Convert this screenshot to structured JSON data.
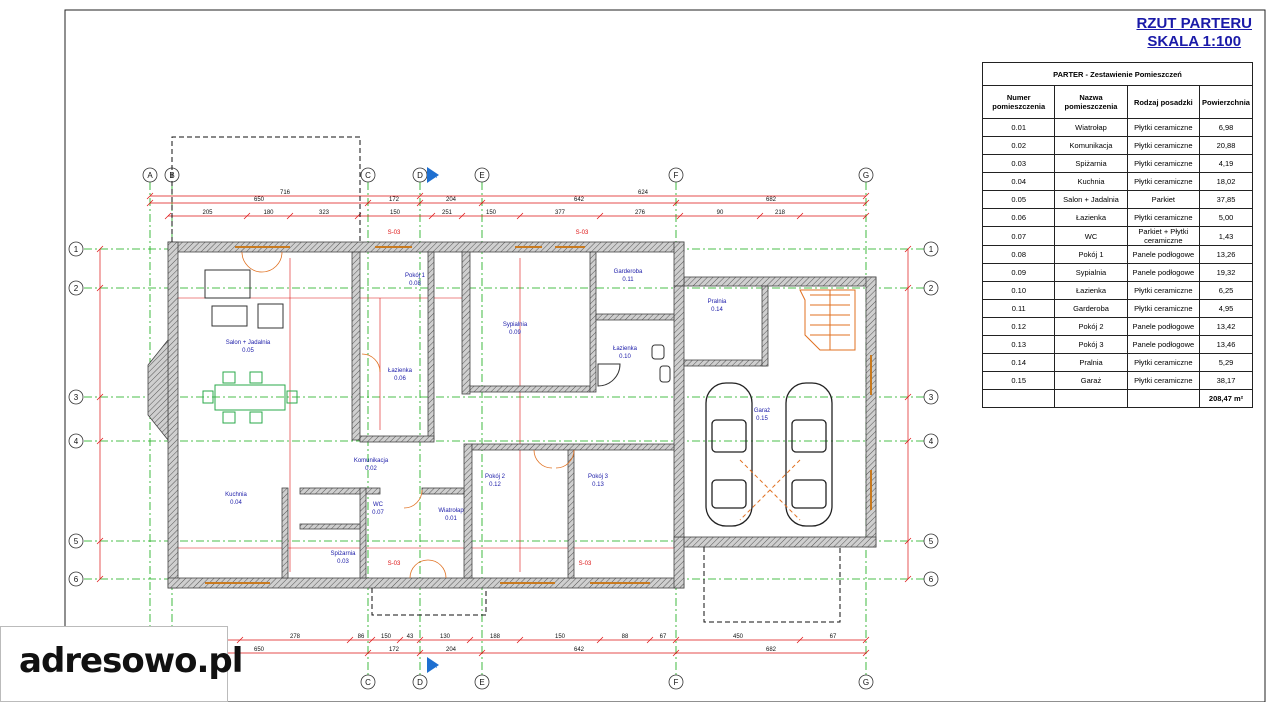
{
  "title": {
    "line1": "RZUT PARTERU",
    "line2": "SKALA 1:100"
  },
  "table": {
    "caption": "PARTER - Zestawienie Pomieszczeń",
    "headers": [
      "Numer pomieszczenia",
      "Nazwa pomieszczenia",
      "Rodzaj posadzki",
      "Powierzchnia"
    ],
    "rows": [
      [
        "0.01",
        "Wiatrołap",
        "Płytki ceramiczne",
        "6,98"
      ],
      [
        "0.02",
        "Komunikacja",
        "Płytki ceramiczne",
        "20,88"
      ],
      [
        "0.03",
        "Spiżarnia",
        "Płytki ceramiczne",
        "4,19"
      ],
      [
        "0.04",
        "Kuchnia",
        "Płytki ceramiczne",
        "18,02"
      ],
      [
        "0.05",
        "Salon + Jadalnia",
        "Parkiet",
        "37,85"
      ],
      [
        "0.06",
        "Łazienka",
        "Płytki ceramiczne",
        "5,00"
      ],
      [
        "0.07",
        "WC",
        "Parkiet + Płytki ceramiczne",
        "1,43"
      ],
      [
        "0.08",
        "Pokój 1",
        "Panele podłogowe",
        "13,26"
      ],
      [
        "0.09",
        "Sypialnia",
        "Panele podłogowe",
        "19,32"
      ],
      [
        "0.10",
        "Łazienka",
        "Płytki ceramiczne",
        "6,25"
      ],
      [
        "0.11",
        "Garderoba",
        "Płytki ceramiczne",
        "4,95"
      ],
      [
        "0.12",
        "Pokój 2",
        "Panele podłogowe",
        "13,42"
      ],
      [
        "0.13",
        "Pokój 3",
        "Panele podłogowe",
        "13,46"
      ],
      [
        "0.14",
        "Pralnia",
        "Płytki ceramiczne",
        "5,29"
      ],
      [
        "0.15",
        "Garaż",
        "Płytki ceramiczne",
        "38,17"
      ]
    ],
    "total": "208,47 m²"
  },
  "plan": {
    "axis_cols": [
      "A",
      "B",
      "C",
      "D",
      "E",
      "F",
      "G"
    ],
    "axis_rows": [
      "1",
      "2",
      "3",
      "4",
      "5",
      "6"
    ],
    "rooms": [
      {
        "name": "Salon + Jadalnia",
        "num": "0.05"
      },
      {
        "name": "Kuchnia",
        "num": "0.04"
      },
      {
        "name": "Pokój 1",
        "num": "0.08"
      },
      {
        "name": "Łazienka",
        "num": "0.06"
      },
      {
        "name": "Sypialnia",
        "num": "0.09"
      },
      {
        "name": "Garderoba",
        "num": "0.11"
      },
      {
        "name": "Łazienka",
        "num": "0.10"
      },
      {
        "name": "Pralnia",
        "num": "0.14"
      },
      {
        "name": "Garaż",
        "num": "0.15"
      },
      {
        "name": "Komunikacja",
        "num": "0.02"
      },
      {
        "name": "WC",
        "num": "0.07"
      },
      {
        "name": "Spiżarnia",
        "num": "0.03"
      },
      {
        "name": "Wiatrołap",
        "num": "0.01"
      },
      {
        "name": "Pokój 2",
        "num": "0.12"
      },
      {
        "name": "Pokój 3",
        "num": "0.13"
      }
    ],
    "dims_top1": [
      "716",
      "624"
    ],
    "dims_top2": [
      "650",
      "172",
      "204",
      "642",
      "682"
    ],
    "dims_top3": [
      "205",
      "180",
      "323",
      "150",
      "251",
      "150",
      "377",
      "276",
      "90",
      "218"
    ],
    "dims_bottom1": [
      "250",
      "278",
      "86",
      "150",
      "43",
      "130",
      "188",
      "150",
      "88",
      "67",
      "450",
      "67"
    ],
    "dims_bottom2": [
      "650",
      "172",
      "204",
      "642",
      "682"
    ],
    "section_marks": [
      "S-03",
      "S-03",
      "S-03",
      "S-03"
    ],
    "section_arrow": "A",
    "colors": {
      "walls": "#555555",
      "dims": "#dd1111",
      "axes": "#11aa11",
      "text": "#1a1aa8",
      "stairs": "#e07020",
      "furniture": "#2aa84a"
    }
  },
  "logo": {
    "text": "adresowo.pl"
  }
}
